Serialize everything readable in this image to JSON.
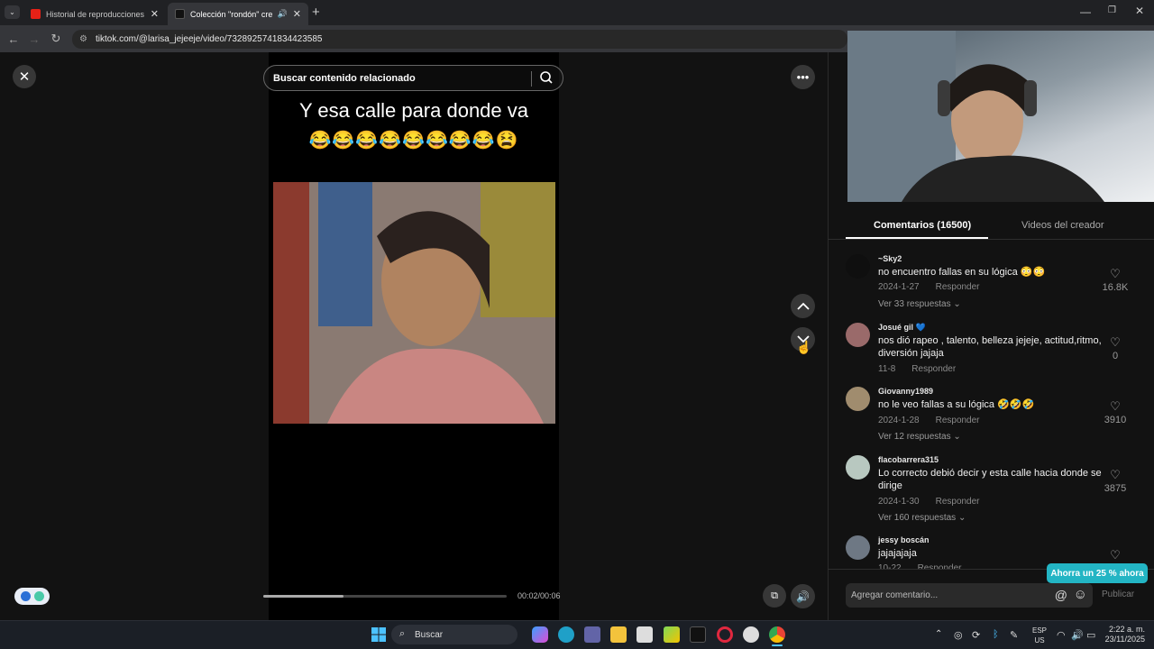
{
  "browser": {
    "tabs": [
      {
        "label": "Historial de reproducciones - Y",
        "favicon_color": "#e62117"
      },
      {
        "label": "Colección \"rondón\" creada",
        "favicon_color": "#111111"
      }
    ],
    "url": "tiktok.com/@larisa_jejeeje/video/7328925741834423585"
  },
  "player": {
    "search_placeholder": "Buscar contenido relacionado",
    "caption": "Y esa calle para donde va",
    "emojis": "😂😂😂😂😂😂😂😂😫",
    "time": "00:02/00:06",
    "progress": 0.33
  },
  "panel": {
    "tab_comments": "Comentarios (16500)",
    "tab_creator": "Videos del creador",
    "reply_label": "Responder",
    "comments": [
      {
        "user": "~Sky2",
        "text": "no encuentro fallas en su lógica 😳😳",
        "date": "2024-1-27",
        "replies": "Ver 33 respuestas",
        "likes": "16.8K",
        "avatar_color": "#0f0f0f"
      },
      {
        "user": "Josué gil 💙",
        "text": "nos dió rapeo , talento, belleza jejeje, actitud,ritmo, diversión jajaja",
        "date": "11-8",
        "replies": "",
        "likes": "0",
        "avatar_color": "#9a6a6a"
      },
      {
        "user": "Giovanny1989",
        "text": "no le veo fallas a su lógica 🤣🤣🤣",
        "date": "2024-1-28",
        "replies": "Ver 12 respuestas",
        "likes": "3910",
        "avatar_color": "#a08c6e"
      },
      {
        "user": "flacobarrera315",
        "text": "Lo correcto debió decir y esta calle hacia donde se dirige",
        "date": "2024-1-30",
        "replies": "Ver 160 respuestas",
        "likes": "3875",
        "avatar_color": "#b8c8c0"
      },
      {
        "user": "jessy boscán",
        "text": "jajajajaja",
        "date": "10-22",
        "replies": "",
        "likes": "",
        "avatar_color": "#6e7884"
      }
    ],
    "promo": "Ahorra un 25 % ahora",
    "input_placeholder": "Agregar comentario...",
    "publish": "Publicar"
  },
  "taskbar": {
    "search": "Buscar",
    "lang": "ESP",
    "region": "US",
    "clock_time": "2:22 a. m.",
    "clock_date": "23/11/2025"
  }
}
